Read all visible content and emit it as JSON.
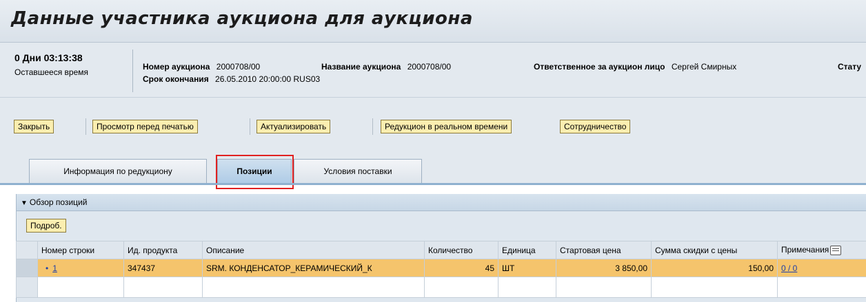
{
  "page": {
    "title": "Данные участника аукциона для аукциона"
  },
  "header": {
    "remaining_time_value": "0 Дни 03:13:38",
    "remaining_time_label": "Оставшееся время",
    "auction_number_label": "Номер аукциона",
    "auction_number_value": "2000708/00",
    "auction_name_label": "Название аукциона",
    "auction_name_value": "2000708/00",
    "responsible_label": "Ответственное за аукцион лицо",
    "responsible_value": "Сергей Смирных",
    "status_label": "Стату",
    "end_date_label": "Срок окончания",
    "end_date_value": "26.05.2010 20:00:00 RUS03"
  },
  "toolbar": {
    "close": "Закрыть",
    "print_preview": "Просмотр перед печатью",
    "refresh": "Актуализировать",
    "live_auction": "Редукцион в реальном времени",
    "collaboration": "Сотрудничество"
  },
  "tabs": [
    {
      "label": "Информация по редукциону"
    },
    {
      "label": "Позиции"
    },
    {
      "label": "Условия поставки"
    }
  ],
  "items_panel": {
    "title": "Обзор позиций",
    "details_button": "Подроб."
  },
  "table": {
    "columns": [
      "Номер строки",
      "Ид. продукта",
      "Описание",
      "Количество",
      "Единица",
      "Стартовая цена",
      "Сумма скидки с цены",
      "Примечания"
    ],
    "rows": [
      {
        "bullet": "•",
        "line": "1",
        "product_id": "347437",
        "description": "SRM. КОНДЕНСАТОР_КЕРАМИЧЕСКИЙ_К",
        "quantity": "45",
        "unit": "ШТ",
        "start_price": "3 850,00",
        "discount": "150,00",
        "notes": "0 / 0"
      }
    ]
  }
}
